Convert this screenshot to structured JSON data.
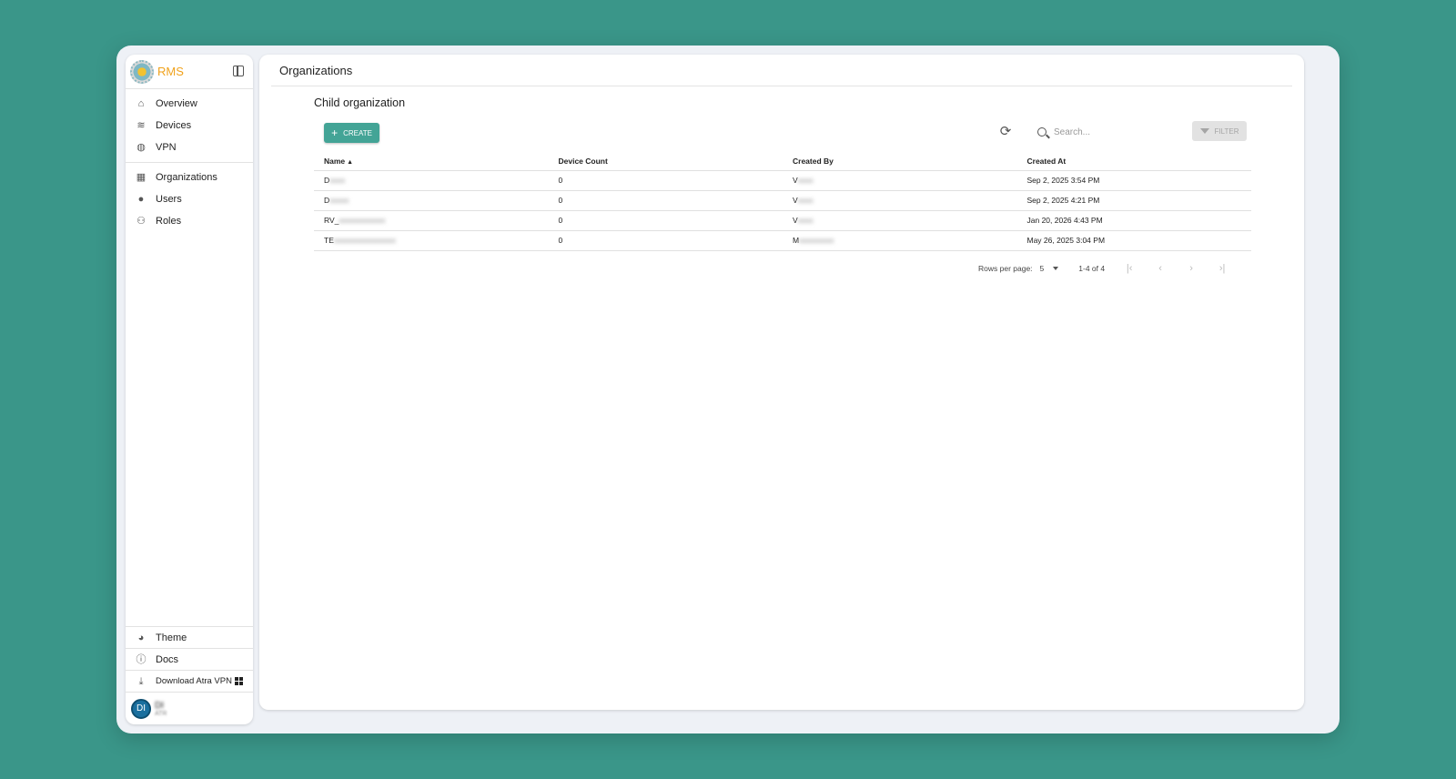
{
  "app": {
    "brand": "RMS"
  },
  "sidebar": {
    "nav_primary": [
      {
        "label": "Overview",
        "icon": "home-icon"
      },
      {
        "label": "Devices",
        "icon": "router-icon"
      },
      {
        "label": "VPN",
        "icon": "vpn-globe-icon"
      }
    ],
    "nav_admin": [
      {
        "label": "Organizations",
        "icon": "building-icon"
      },
      {
        "label": "Users",
        "icon": "person-icon"
      },
      {
        "label": "Roles",
        "icon": "roles-icon"
      }
    ],
    "bottom": {
      "theme_label": "Theme",
      "docs_label": "Docs",
      "download_label": "Download Atra VPN"
    },
    "user": {
      "avatar_initials": "DI",
      "name": "DI",
      "subtitle": "ATR"
    }
  },
  "main": {
    "page_title": "Organizations",
    "section_title": "Child organization",
    "create_label": "CREATE",
    "search_placeholder": "Search...",
    "filter_label": "FILTER",
    "table": {
      "headers": {
        "name": "Name",
        "device_count": "Device Count",
        "created_by": "Created By",
        "created_at": "Created At"
      },
      "sort_indicator": "▲",
      "rows": [
        {
          "name": "D",
          "device_count": "0",
          "created_by": "V",
          "created_at": "Sep 2, 2025 3:54 PM"
        },
        {
          "name": "D",
          "device_count": "0",
          "created_by": "V",
          "created_at": "Sep 2, 2025 4:21 PM"
        },
        {
          "name": "RV_",
          "device_count": "0",
          "created_by": "V",
          "created_at": "Jan 20, 2026 4:43 PM"
        },
        {
          "name": "TE",
          "device_count": "0",
          "created_by": "M",
          "created_at": "May 26, 2025 3:04 PM"
        }
      ]
    },
    "pagination": {
      "rows_per_page_label": "Rows per page:",
      "rows_per_page_value": "5",
      "range": "1-4 of 4"
    }
  },
  "colors": {
    "background": "#3a9689",
    "accent": "#43a496",
    "brand": "#f0a21c"
  }
}
